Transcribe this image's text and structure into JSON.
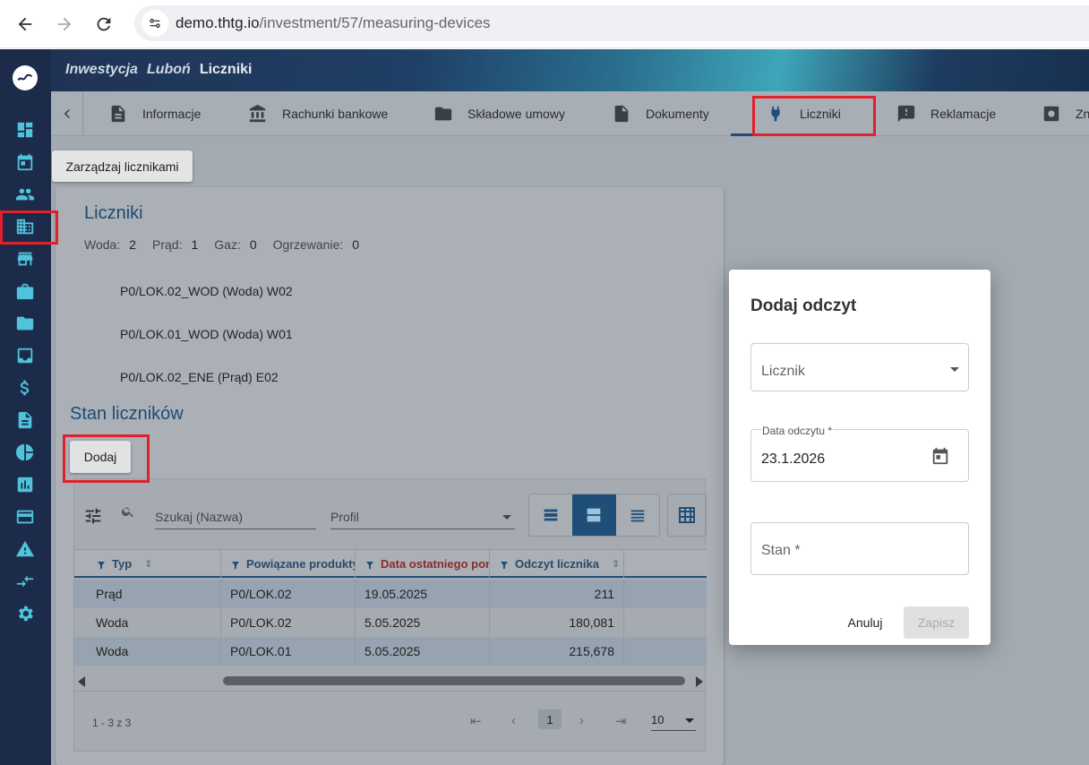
{
  "browser": {
    "url_host": "demo.thtg.io",
    "url_path": "/investment/57/measuring-devices"
  },
  "header": {
    "breadcrumb": [
      "Inwestycja",
      "Luboń"
    ],
    "current": "Liczniki"
  },
  "tabs": [
    {
      "label": "Informacje",
      "icon": "document-icon"
    },
    {
      "label": "Rachunki bankowe",
      "icon": "bank-icon"
    },
    {
      "label": "Składowe umowy",
      "icon": "folder-icon"
    },
    {
      "label": "Dokumenty",
      "icon": "file-icon"
    },
    {
      "label": "Liczniki",
      "icon": "plug-icon",
      "active": true
    },
    {
      "label": "Reklamacje",
      "icon": "feedback-icon"
    },
    {
      "label": "Zn",
      "icon": "settings-box-icon"
    }
  ],
  "manage_button": "Zarządzaj licznikami",
  "meters": {
    "title": "Liczniki",
    "counts": [
      {
        "label": "Woda:",
        "value": "2"
      },
      {
        "label": "Prąd:",
        "value": "1"
      },
      {
        "label": "Gaz:",
        "value": "0"
      },
      {
        "label": "Ogrzewanie:",
        "value": "0"
      }
    ],
    "list": [
      "P0/LOK.02_WOD (Woda) W02",
      "P0/LOK.01_WOD (Woda) W01",
      "P0/LOK.02_ENE (Prąd) E02"
    ]
  },
  "readings": {
    "title": "Stan liczników",
    "add_button": "Dodaj",
    "search_placeholder": "Szukaj (Nazwa)",
    "profile_placeholder": "Profil",
    "columns": [
      "Typ",
      "Powiązane produkty",
      "Data ostatniego pomiaru",
      "Odczyt licznika"
    ],
    "rows": [
      {
        "type": "Prąd",
        "product": "P0/LOK.02",
        "date": "19.05.2025",
        "reading": "211"
      },
      {
        "type": "Woda",
        "product": "P0/LOK.02",
        "date": "5.05.2025",
        "reading": "180,081"
      },
      {
        "type": "Woda",
        "product": "P0/LOK.01",
        "date": "5.05.2025",
        "reading": "215,678"
      }
    ],
    "pager": {
      "info": "1 - 3 z 3",
      "page": "1",
      "page_size": "10"
    }
  },
  "dialog": {
    "title": "Dodaj odczyt",
    "meter_label": "Licznik",
    "date_label": "Data odczytu *",
    "date_value": "23.1.2026",
    "state_label": "Stan *",
    "cancel": "Anuluj",
    "save": "Zapisz"
  },
  "colors": {
    "sidebar": "#1c2b4a",
    "accent": "#1f4f78",
    "icon": "#4fc3d9",
    "highlight": "#e0202a"
  }
}
